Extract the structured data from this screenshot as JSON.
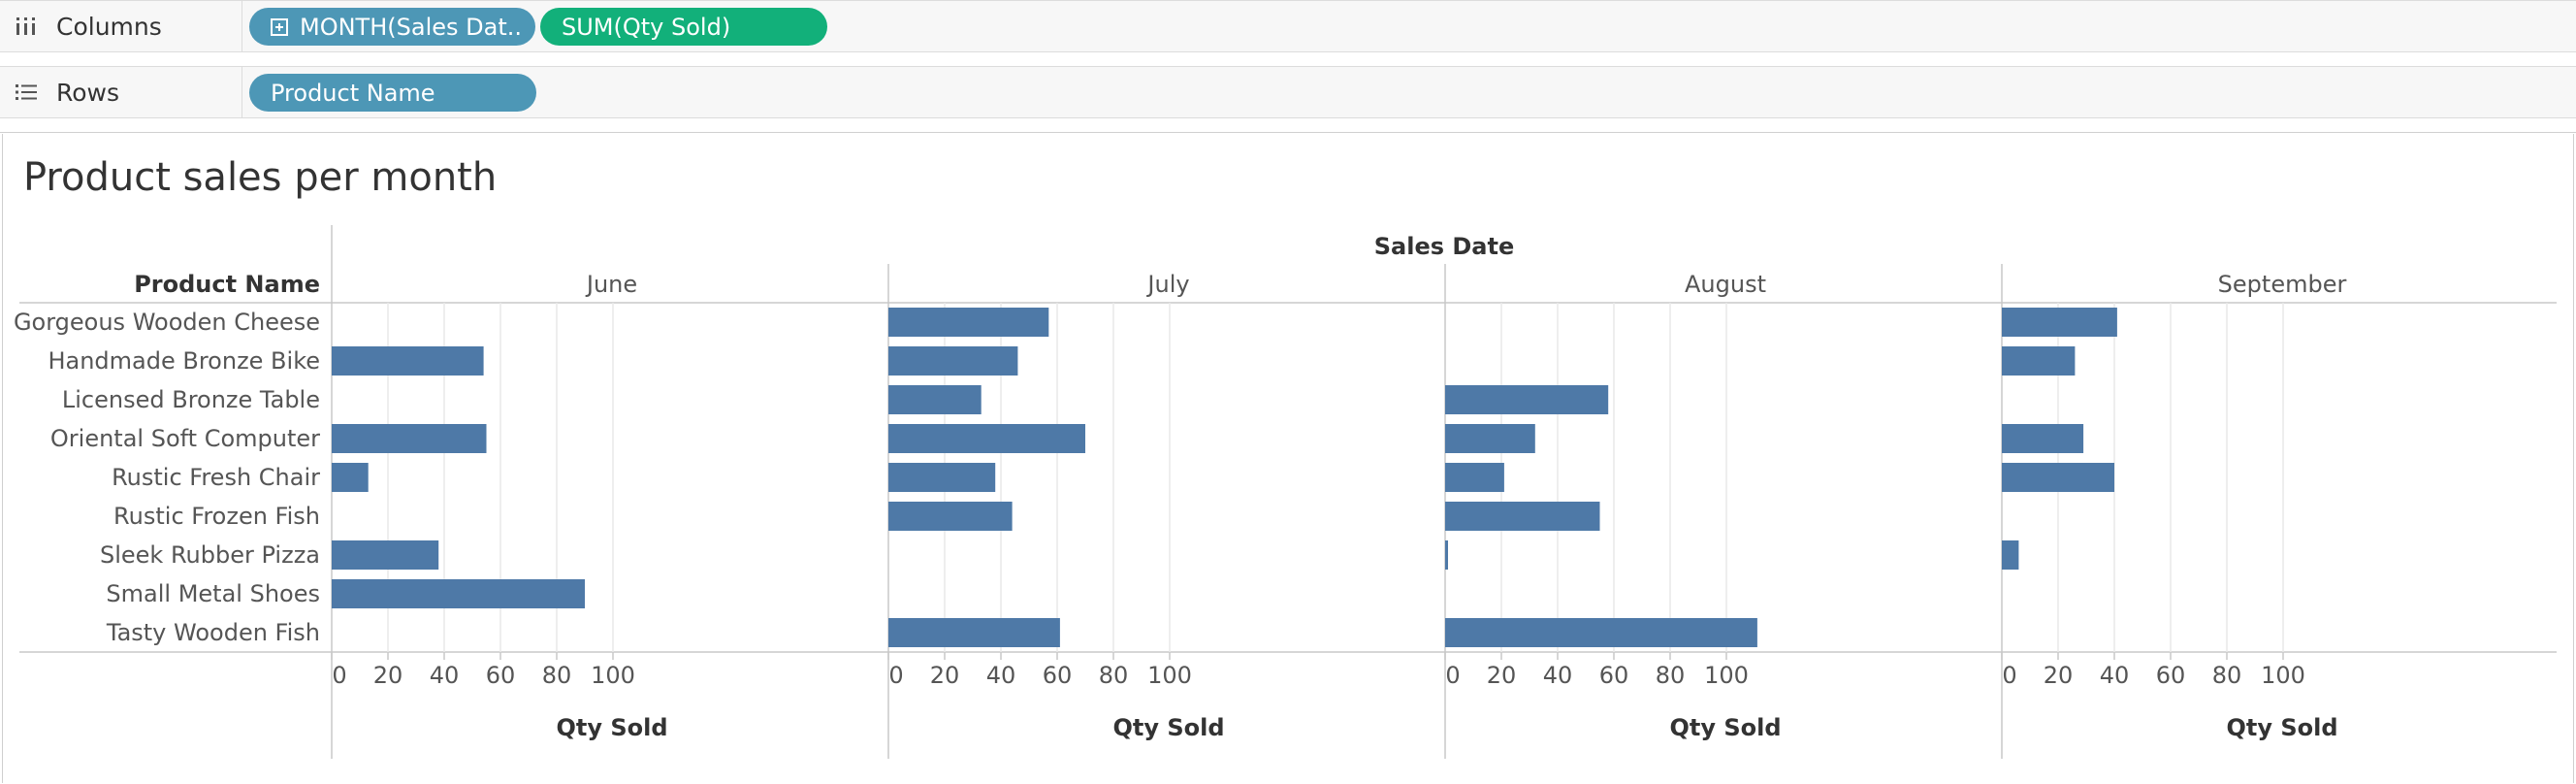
{
  "shelves": {
    "columns": {
      "label": "Columns",
      "icon": "columns-icon",
      "pills": [
        {
          "text": "MONTH(Sales Dat..",
          "color": "#4d97b6",
          "expandable": true
        },
        {
          "text": "SUM(Qty Sold)",
          "color": "#12b07a",
          "expandable": false
        }
      ]
    },
    "rows": {
      "label": "Rows",
      "icon": "rows-list-icon",
      "pills": [
        {
          "text": "Product Name",
          "color": "#4d97b6",
          "expandable": false
        }
      ]
    }
  },
  "chart_data": {
    "type": "bar",
    "orientation": "horizontal",
    "title": "Product sales per month",
    "row_header": "Product Name",
    "column_header": "Sales Date",
    "xlabel": "Qty Sold",
    "xlim": [
      0,
      115
    ],
    "xticks": [
      0,
      20,
      40,
      60,
      80,
      100
    ],
    "bar_color": "#4e79a7",
    "categories": [
      "Gorgeous Wooden Cheese",
      "Handmade Bronze Bike",
      "Licensed Bronze Table",
      "Oriental Soft Computer",
      "Rustic Fresh Chair",
      "Rustic Frozen Fish",
      "Sleek Rubber Pizza",
      "Small Metal Shoes",
      "Tasty Wooden Fish"
    ],
    "panels": [
      {
        "name": "June",
        "values": [
          null,
          54,
          null,
          55,
          13,
          null,
          38,
          90,
          null
        ]
      },
      {
        "name": "July",
        "values": [
          57,
          46,
          33,
          70,
          38,
          44,
          null,
          null,
          61
        ]
      },
      {
        "name": "August",
        "values": [
          null,
          null,
          58,
          32,
          21,
          55,
          1,
          null,
          111
        ]
      },
      {
        "name": "September",
        "values": [
          41,
          26,
          null,
          29,
          40,
          null,
          6,
          null,
          null
        ]
      }
    ]
  }
}
